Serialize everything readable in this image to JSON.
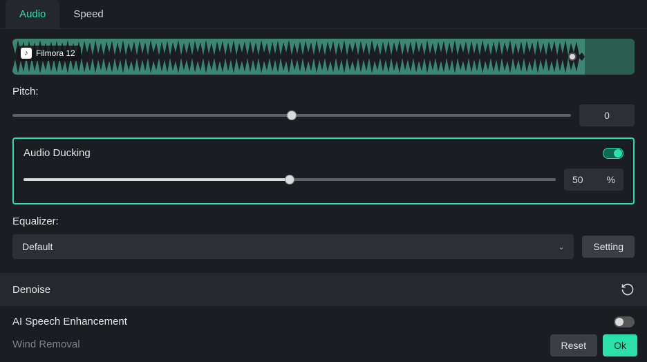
{
  "tabs": {
    "audio": "Audio",
    "speed": "Speed"
  },
  "clip": {
    "name": "Filmora 12"
  },
  "pitch": {
    "label": "Pitch:",
    "value": "0",
    "pos": 50
  },
  "ducking": {
    "label": "Audio Ducking",
    "value": "50",
    "unit": "%",
    "pos": 50,
    "enabled": true
  },
  "equalizer": {
    "label": "Equalizer:",
    "selected": "Default",
    "setting_btn": "Setting"
  },
  "denoise": {
    "label": "Denoise"
  },
  "ai_speech": {
    "label": "AI Speech Enhancement",
    "enabled": false
  },
  "wind": {
    "label": "Wind Removal",
    "enabled": false
  },
  "footer": {
    "reset": "Reset",
    "ok": "Ok"
  }
}
